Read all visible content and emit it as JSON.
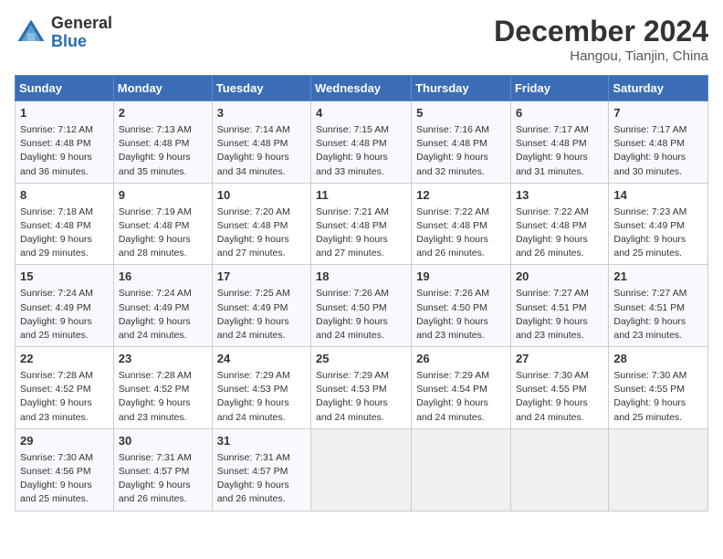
{
  "header": {
    "logo_general": "General",
    "logo_blue": "Blue",
    "title": "December 2024",
    "location": "Hangou, Tianjin, China"
  },
  "days_of_week": [
    "Sunday",
    "Monday",
    "Tuesday",
    "Wednesday",
    "Thursday",
    "Friday",
    "Saturday"
  ],
  "weeks": [
    [
      {
        "day": "1",
        "lines": [
          "Sunrise: 7:12 AM",
          "Sunset: 4:48 PM",
          "Daylight: 9 hours",
          "and 36 minutes."
        ]
      },
      {
        "day": "2",
        "lines": [
          "Sunrise: 7:13 AM",
          "Sunset: 4:48 PM",
          "Daylight: 9 hours",
          "and 35 minutes."
        ]
      },
      {
        "day": "3",
        "lines": [
          "Sunrise: 7:14 AM",
          "Sunset: 4:48 PM",
          "Daylight: 9 hours",
          "and 34 minutes."
        ]
      },
      {
        "day": "4",
        "lines": [
          "Sunrise: 7:15 AM",
          "Sunset: 4:48 PM",
          "Daylight: 9 hours",
          "and 33 minutes."
        ]
      },
      {
        "day": "5",
        "lines": [
          "Sunrise: 7:16 AM",
          "Sunset: 4:48 PM",
          "Daylight: 9 hours",
          "and 32 minutes."
        ]
      },
      {
        "day": "6",
        "lines": [
          "Sunrise: 7:17 AM",
          "Sunset: 4:48 PM",
          "Daylight: 9 hours",
          "and 31 minutes."
        ]
      },
      {
        "day": "7",
        "lines": [
          "Sunrise: 7:17 AM",
          "Sunset: 4:48 PM",
          "Daylight: 9 hours",
          "and 30 minutes."
        ]
      }
    ],
    [
      {
        "day": "8",
        "lines": [
          "Sunrise: 7:18 AM",
          "Sunset: 4:48 PM",
          "Daylight: 9 hours",
          "and 29 minutes."
        ]
      },
      {
        "day": "9",
        "lines": [
          "Sunrise: 7:19 AM",
          "Sunset: 4:48 PM",
          "Daylight: 9 hours",
          "and 28 minutes."
        ]
      },
      {
        "day": "10",
        "lines": [
          "Sunrise: 7:20 AM",
          "Sunset: 4:48 PM",
          "Daylight: 9 hours",
          "and 27 minutes."
        ]
      },
      {
        "day": "11",
        "lines": [
          "Sunrise: 7:21 AM",
          "Sunset: 4:48 PM",
          "Daylight: 9 hours",
          "and 27 minutes."
        ]
      },
      {
        "day": "12",
        "lines": [
          "Sunrise: 7:22 AM",
          "Sunset: 4:48 PM",
          "Daylight: 9 hours",
          "and 26 minutes."
        ]
      },
      {
        "day": "13",
        "lines": [
          "Sunrise: 7:22 AM",
          "Sunset: 4:48 PM",
          "Daylight: 9 hours",
          "and 26 minutes."
        ]
      },
      {
        "day": "14",
        "lines": [
          "Sunrise: 7:23 AM",
          "Sunset: 4:49 PM",
          "Daylight: 9 hours",
          "and 25 minutes."
        ]
      }
    ],
    [
      {
        "day": "15",
        "lines": [
          "Sunrise: 7:24 AM",
          "Sunset: 4:49 PM",
          "Daylight: 9 hours",
          "and 25 minutes."
        ]
      },
      {
        "day": "16",
        "lines": [
          "Sunrise: 7:24 AM",
          "Sunset: 4:49 PM",
          "Daylight: 9 hours",
          "and 24 minutes."
        ]
      },
      {
        "day": "17",
        "lines": [
          "Sunrise: 7:25 AM",
          "Sunset: 4:49 PM",
          "Daylight: 9 hours",
          "and 24 minutes."
        ]
      },
      {
        "day": "18",
        "lines": [
          "Sunrise: 7:26 AM",
          "Sunset: 4:50 PM",
          "Daylight: 9 hours",
          "and 24 minutes."
        ]
      },
      {
        "day": "19",
        "lines": [
          "Sunrise: 7:26 AM",
          "Sunset: 4:50 PM",
          "Daylight: 9 hours",
          "and 23 minutes."
        ]
      },
      {
        "day": "20",
        "lines": [
          "Sunrise: 7:27 AM",
          "Sunset: 4:51 PM",
          "Daylight: 9 hours",
          "and 23 minutes."
        ]
      },
      {
        "day": "21",
        "lines": [
          "Sunrise: 7:27 AM",
          "Sunset: 4:51 PM",
          "Daylight: 9 hours",
          "and 23 minutes."
        ]
      }
    ],
    [
      {
        "day": "22",
        "lines": [
          "Sunrise: 7:28 AM",
          "Sunset: 4:52 PM",
          "Daylight: 9 hours",
          "and 23 minutes."
        ]
      },
      {
        "day": "23",
        "lines": [
          "Sunrise: 7:28 AM",
          "Sunset: 4:52 PM",
          "Daylight: 9 hours",
          "and 23 minutes."
        ]
      },
      {
        "day": "24",
        "lines": [
          "Sunrise: 7:29 AM",
          "Sunset: 4:53 PM",
          "Daylight: 9 hours",
          "and 24 minutes."
        ]
      },
      {
        "day": "25",
        "lines": [
          "Sunrise: 7:29 AM",
          "Sunset: 4:53 PM",
          "Daylight: 9 hours",
          "and 24 minutes."
        ]
      },
      {
        "day": "26",
        "lines": [
          "Sunrise: 7:29 AM",
          "Sunset: 4:54 PM",
          "Daylight: 9 hours",
          "and 24 minutes."
        ]
      },
      {
        "day": "27",
        "lines": [
          "Sunrise: 7:30 AM",
          "Sunset: 4:55 PM",
          "Daylight: 9 hours",
          "and 24 minutes."
        ]
      },
      {
        "day": "28",
        "lines": [
          "Sunrise: 7:30 AM",
          "Sunset: 4:55 PM",
          "Daylight: 9 hours",
          "and 25 minutes."
        ]
      }
    ],
    [
      {
        "day": "29",
        "lines": [
          "Sunrise: 7:30 AM",
          "Sunset: 4:56 PM",
          "Daylight: 9 hours",
          "and 25 minutes."
        ]
      },
      {
        "day": "30",
        "lines": [
          "Sunrise: 7:31 AM",
          "Sunset: 4:57 PM",
          "Daylight: 9 hours",
          "and 26 minutes."
        ]
      },
      {
        "day": "31",
        "lines": [
          "Sunrise: 7:31 AM",
          "Sunset: 4:57 PM",
          "Daylight: 9 hours",
          "and 26 minutes."
        ]
      },
      {
        "day": "",
        "lines": []
      },
      {
        "day": "",
        "lines": []
      },
      {
        "day": "",
        "lines": []
      },
      {
        "day": "",
        "lines": []
      }
    ]
  ]
}
